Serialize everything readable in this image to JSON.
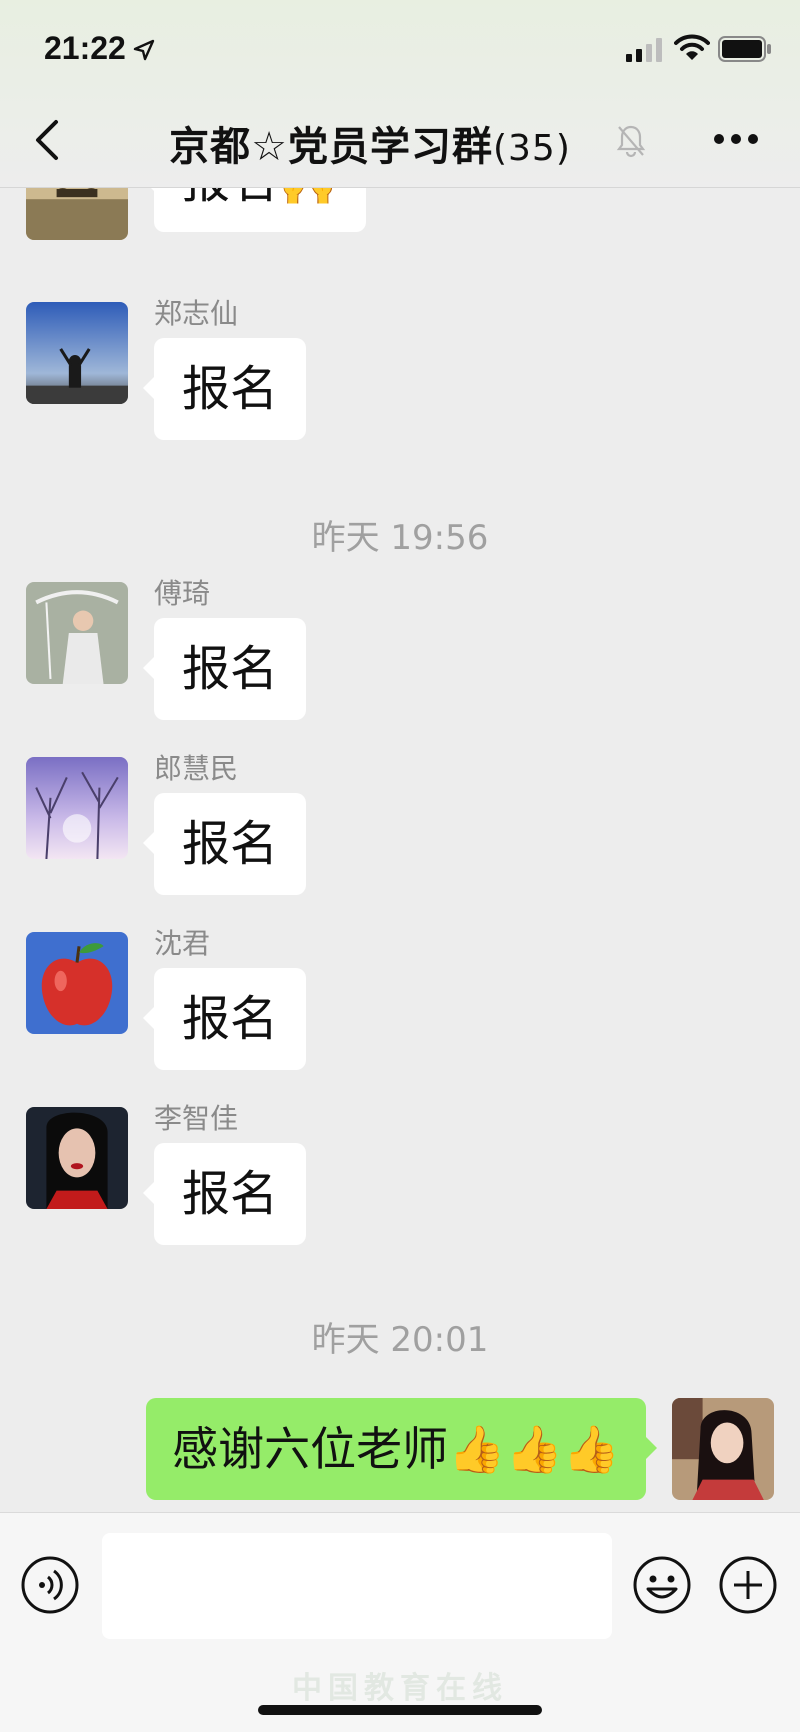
{
  "status_bar": {
    "time": "21:22"
  },
  "header": {
    "title": "京都☆党员学习群",
    "member_count": "(35)"
  },
  "messages": [
    {
      "sender": "",
      "text": "报名🙌"
    },
    {
      "sender": "郑志仙",
      "text": "报名"
    },
    {
      "timestamp": "昨天 19:56"
    },
    {
      "sender": "傅琦",
      "text": "报名"
    },
    {
      "sender": "郎慧民",
      "text": "报名"
    },
    {
      "sender": "沈君",
      "text": "报名"
    },
    {
      "sender": "李智佳",
      "text": "报名"
    },
    {
      "timestamp": "昨天 20:01"
    },
    {
      "sender": "",
      "text": "感谢六位老师👍👍👍",
      "mine": true
    }
  ],
  "input": {
    "value": ""
  },
  "watermark": "中国教育在线"
}
